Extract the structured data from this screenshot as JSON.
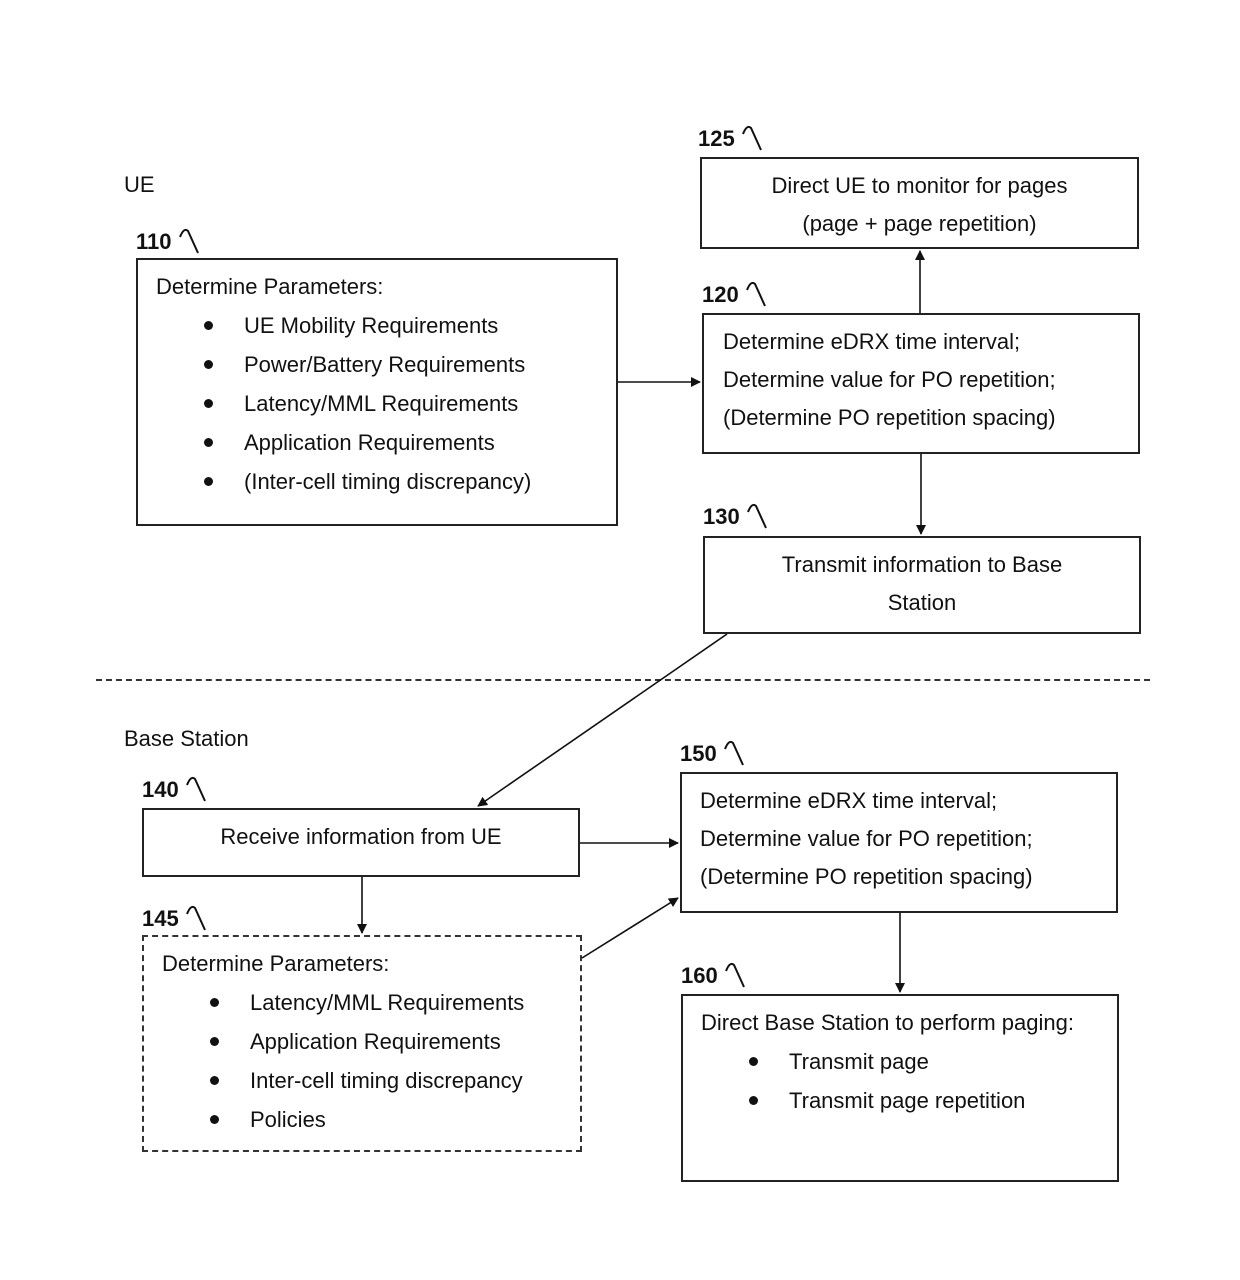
{
  "sections": {
    "ue_label": "UE",
    "base_station_label": "Base Station"
  },
  "nodes": {
    "n110": {
      "ref": "110",
      "title": "Determine Parameters:",
      "bullets": [
        "UE Mobility Requirements",
        "Power/Battery Requirements",
        "Latency/MML Requirements",
        "Application Requirements",
        "(Inter-cell timing discrepancy)"
      ]
    },
    "n125": {
      "ref": "125",
      "lines": [
        "Direct UE to monitor for pages",
        "(page + page repetition)"
      ]
    },
    "n120": {
      "ref": "120",
      "lines": [
        "Determine eDRX time interval;",
        "Determine value for PO repetition;",
        "(Determine PO repetition spacing)"
      ]
    },
    "n130": {
      "ref": "130",
      "lines": [
        "Transmit information to Base",
        "Station"
      ]
    },
    "n140": {
      "ref": "140",
      "lines": [
        "Receive information from UE"
      ]
    },
    "n145": {
      "ref": "145",
      "title": "Determine Parameters:",
      "bullets": [
        "Latency/MML Requirements",
        "Application Requirements",
        "Inter-cell timing discrepancy",
        "Policies"
      ]
    },
    "n150": {
      "ref": "150",
      "lines": [
        "Determine eDRX time interval;",
        "Determine value for PO repetition;",
        "(Determine PO repetition spacing)"
      ]
    },
    "n160": {
      "ref": "160",
      "title": "Direct Base Station to perform paging:",
      "bullets": [
        "Transmit page",
        "Transmit page repetition"
      ]
    }
  },
  "edges": [
    {
      "from": "110",
      "to": "120"
    },
    {
      "from": "120",
      "to": "125"
    },
    {
      "from": "120",
      "to": "130"
    },
    {
      "from": "130",
      "to": "140"
    },
    {
      "from": "140",
      "to": "150"
    },
    {
      "from": "140",
      "to": "145"
    },
    {
      "from": "145",
      "to": "150"
    },
    {
      "from": "150",
      "to": "160"
    }
  ]
}
